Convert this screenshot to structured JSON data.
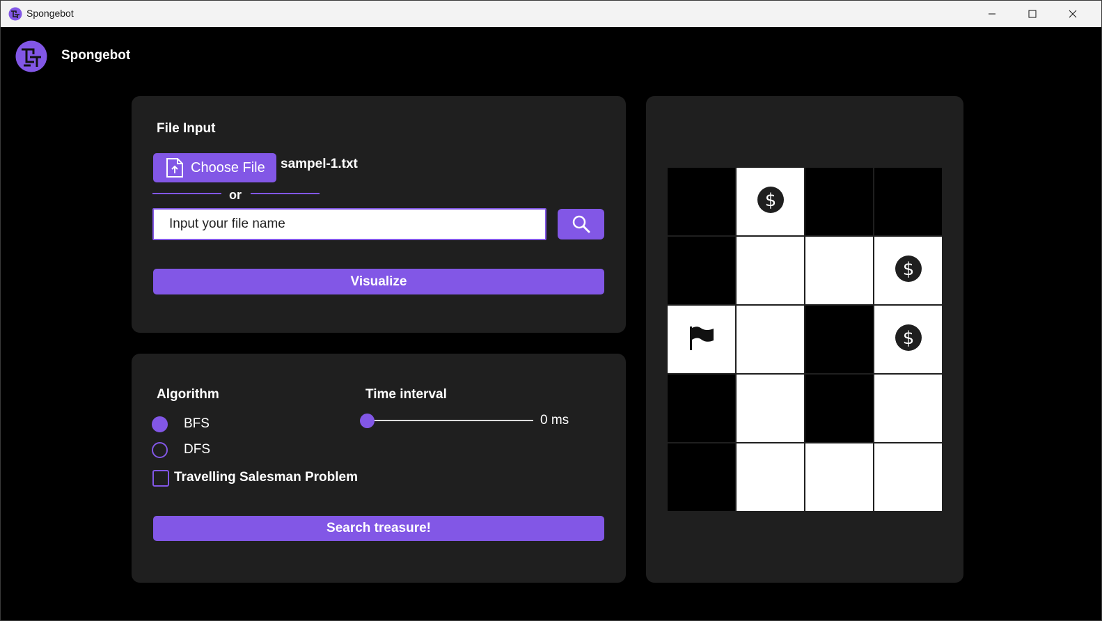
{
  "window": {
    "title": "Spongebot"
  },
  "header": {
    "app_name": "Spongebot"
  },
  "file_panel": {
    "heading": "File Input",
    "choose_file_label": "Choose File",
    "selected_file": "sampel-1.txt",
    "or_label": "or",
    "file_input_placeholder": "Input your file name",
    "visualize_label": "Visualize"
  },
  "algorithm_panel": {
    "algorithm_heading": "Algorithm",
    "options": [
      {
        "label": "BFS",
        "selected": true
      },
      {
        "label": "DFS",
        "selected": false
      }
    ],
    "tsp_label": "Travelling Salesman Problem",
    "tsp_checked": false,
    "time_interval_heading": "Time interval",
    "time_interval_value": "0 ms",
    "search_label": "Search treasure!"
  },
  "maze": {
    "rows": 5,
    "cols": 4,
    "cells": [
      [
        "wall",
        "treasure",
        "wall",
        "wall"
      ],
      [
        "wall",
        "path",
        "path",
        "treasure"
      ],
      [
        "start",
        "path",
        "wall",
        "treasure"
      ],
      [
        "wall",
        "path",
        "wall",
        "path"
      ],
      [
        "wall",
        "path",
        "path",
        "path"
      ]
    ]
  },
  "colors": {
    "accent": "#8257e6",
    "panel": "#1f1f1f",
    "background": "#000000"
  }
}
